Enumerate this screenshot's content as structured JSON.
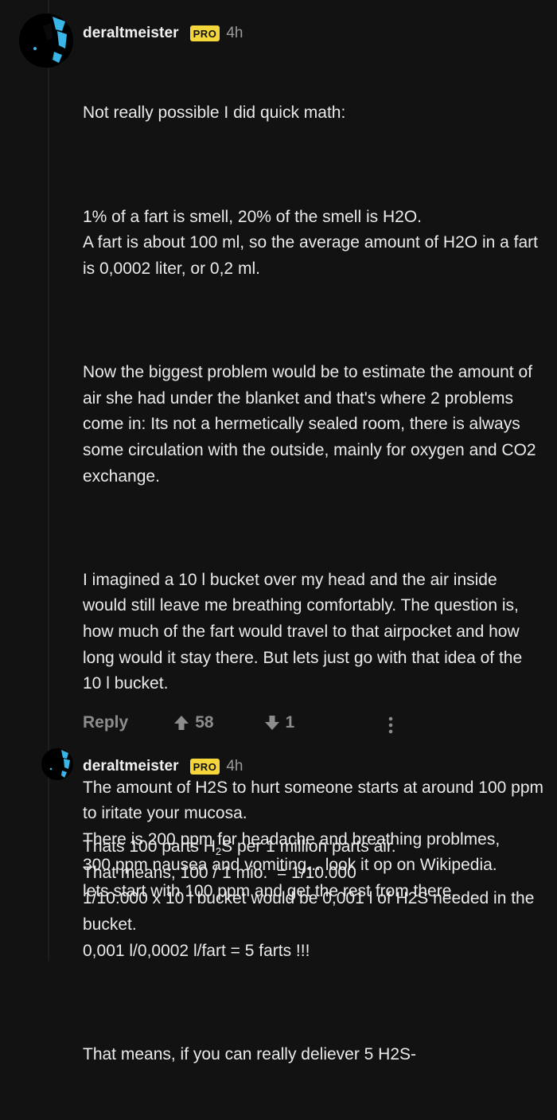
{
  "comments": [
    {
      "username": "deraltmeister",
      "badge": "PRO",
      "time": "4h",
      "avatar_icon": "user-avatar-icon",
      "paragraphs": [
        "Not really possible I did quick math:",
        "1% of a fart is smell, 20% of the smell is H2O.\nA fart is about 100 ml, so the average amount of H2O in a fart is 0,0002 liter, or 0,2 ml.",
        "Now the biggest problem would be to estimate the amount of air she had under the blanket and that's where 2 problems come in: Its not a hermetically sealed room, there is always some circulation with the outside, mainly for oxygen and CO2 exchange.",
        "I imagined a 10 l bucket over my head and the air inside would still leave me breathing comfortably. The question is, how much of the fart would travel to that airpocket and how long would it stay there. But lets just go with that idea of the 10 l bucket.",
        "The amount of H2S to hurt someone starts at around 100 ppm to iritate your mucosa.\nThere is 200 ppm for headache and breathing problmes,\n300 ppm nausea and vomiting... look it op on Wikipedia.\nlets start with 100 ppm and get the rest from there."
      ],
      "actions": {
        "reply_label": "Reply",
        "upvotes": "58",
        "downvotes": "1"
      }
    },
    {
      "username": "deraltmeister",
      "badge": "PRO",
      "time": "4h",
      "avatar_icon": "user-avatar-icon",
      "line1_before_sub": "Thats 100 parts H",
      "line1_sub": "2",
      "line1_after_sub": "S per 1 million parts air.",
      "paragraph1_rest": "That means, 100 / 1 mio.  = 1/10.000\n1/10.000 x 10 l bucket would be 0,001 l of H2S needed in the bucket.\n0,001 l/0,0002 l/fart = 5 farts !!!",
      "paragraph2": "That means, if you can really deliever 5 H2S-"
    }
  ],
  "colors": {
    "background": "#121212",
    "badge": "#f4d63b",
    "avatar_accent": "#39b6e8"
  }
}
